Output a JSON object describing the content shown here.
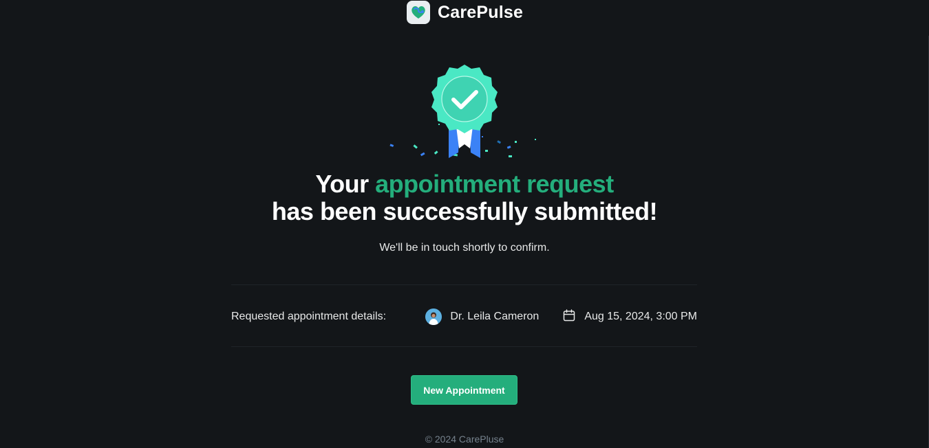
{
  "brand": {
    "name": "CarePulse",
    "logo_icon": "heart-stethoscope-icon",
    "accent_color": "#24ae7c"
  },
  "success": {
    "badge_icon": "check-badge-icon",
    "title_part1": "Your ",
    "title_highlight": "appointment request",
    "title_part2": " has been successfully submitted!",
    "subtitle": "We'll be in touch shortly to confirm."
  },
  "details": {
    "label": "Requested appointment details:",
    "doctor_name": "Dr. Leila Cameron",
    "doctor_avatar_icon": "doctor-avatar",
    "calendar_icon": "calendar-icon",
    "datetime": "Aug 15, 2024, 3:00 PM"
  },
  "actions": {
    "new_appointment_label": "New Appointment"
  },
  "footer": {
    "copyright": "© 2024 CarePluse"
  },
  "colors": {
    "background": "#131619",
    "accent": "#24ae7c",
    "badge": "#4ae8c4",
    "ribbon": "#3b82f6",
    "muted_text": "#76828d"
  }
}
